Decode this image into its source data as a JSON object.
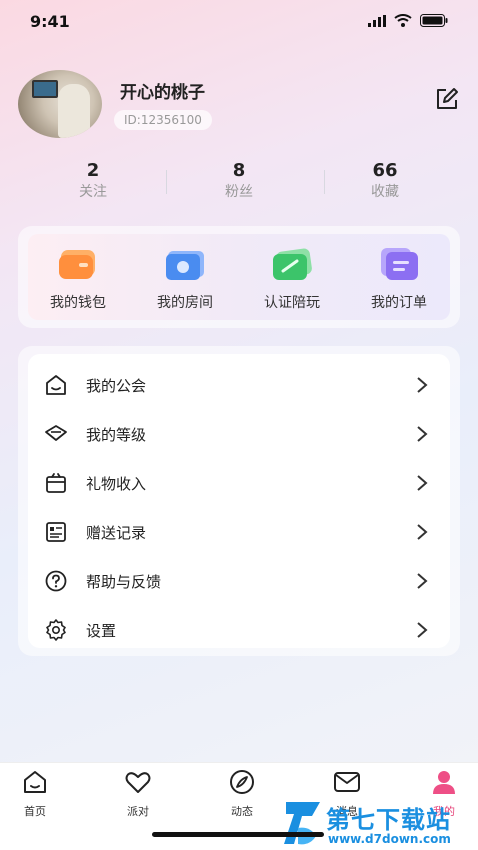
{
  "status_bar": {
    "time": "9:41"
  },
  "profile": {
    "username": "开心的桃子",
    "user_id": "ID:12356100"
  },
  "stats": [
    {
      "value": "2",
      "label": "关注"
    },
    {
      "value": "8",
      "label": "粉丝"
    },
    {
      "value": "66",
      "label": "收藏"
    }
  ],
  "quick_actions": [
    {
      "label": "我的钱包",
      "icon": "wallet-icon",
      "color": "#ff9a4d"
    },
    {
      "label": "我的房间",
      "icon": "room-icon",
      "color": "#4a8cf0"
    },
    {
      "label": "认证陪玩",
      "icon": "certify-icon",
      "color": "#3cc46a"
    },
    {
      "label": "我的订单",
      "icon": "order-icon",
      "color": "#8c6ff2"
    }
  ],
  "menu": [
    {
      "label": "我的公会",
      "icon": "guild-icon"
    },
    {
      "label": "我的等级",
      "icon": "level-icon"
    },
    {
      "label": "礼物收入",
      "icon": "gift-icon"
    },
    {
      "label": "赠送记录",
      "icon": "record-icon"
    },
    {
      "label": "帮助与反馈",
      "icon": "help-icon"
    },
    {
      "label": "设置",
      "icon": "settings-icon"
    }
  ],
  "tabs": [
    {
      "label": "首页",
      "icon": "home-icon",
      "active": false
    },
    {
      "label": "派对",
      "icon": "heart-icon",
      "active": false
    },
    {
      "label": "动态",
      "icon": "compass-icon",
      "active": false
    },
    {
      "label": "消息",
      "icon": "mail-icon",
      "active": false
    },
    {
      "label": "我的",
      "icon": "profile-icon",
      "active": true
    }
  ],
  "watermark": {
    "title": "第七下载站",
    "url": "www.d7down.com"
  },
  "colors": {
    "accent": "#e6447a",
    "watermark": "#1a8fe0"
  }
}
